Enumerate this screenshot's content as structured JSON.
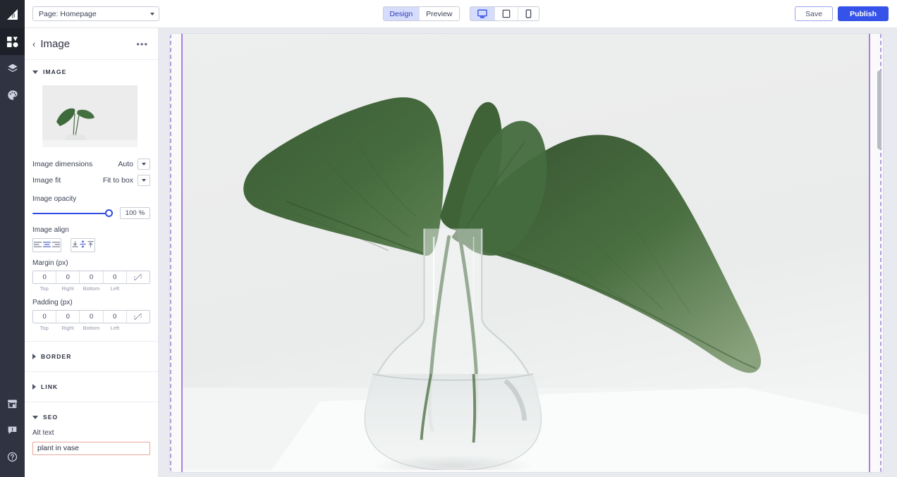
{
  "topbar": {
    "page_select": {
      "value": "Page: Homepage",
      "icon": "chevron-down-icon"
    },
    "modes": [
      {
        "label": "Design",
        "active": true
      },
      {
        "label": "Preview",
        "active": false
      }
    ],
    "devices": [
      {
        "icon": "desktop-icon",
        "active": true
      },
      {
        "icon": "tablet-icon",
        "active": false
      },
      {
        "icon": "mobile-icon",
        "active": false
      }
    ],
    "save_label": "Save",
    "publish_label": "Publish"
  },
  "rail": {
    "logo": "builder-logo",
    "items": [
      {
        "icon": "widgets-icon",
        "active": true
      },
      {
        "icon": "layers-icon",
        "active": false
      },
      {
        "icon": "palette-icon",
        "active": false
      }
    ],
    "bottom_items": [
      {
        "icon": "store-icon"
      },
      {
        "icon": "feedback-icon"
      },
      {
        "icon": "help-icon"
      }
    ]
  },
  "panel": {
    "back_icon": "chevron-left-icon",
    "title": "Image",
    "more_icon": "ellipsis-icon",
    "sections": {
      "image": {
        "label": "IMAGE",
        "expanded": true,
        "thumbnail_alt": "plant in vase thumbnail",
        "dimensions": {
          "label": "Image dimensions",
          "value": "Auto"
        },
        "fit": {
          "label": "Image fit",
          "value": "Fit to box"
        },
        "opacity": {
          "label": "Image opacity",
          "value": "100",
          "unit": "%",
          "percent": 100
        },
        "align": {
          "label": "Image align",
          "horizontal": [
            {
              "icon": "align-left-icon",
              "active": false
            },
            {
              "icon": "align-center-icon",
              "active": true
            },
            {
              "icon": "align-right-icon",
              "active": false
            }
          ],
          "vertical": [
            {
              "icon": "align-bottom-icon",
              "active": false
            },
            {
              "icon": "align-middle-icon",
              "active": true
            },
            {
              "icon": "align-top-icon",
              "active": false
            }
          ]
        },
        "margin": {
          "title": "Margin (px)",
          "values": [
            "0",
            "0",
            "0",
            "0"
          ],
          "captions": [
            "Top",
            "Right",
            "Bottom",
            "Left"
          ],
          "link_icon": "unlink-icon"
        },
        "padding": {
          "title": "Padding (px)",
          "values": [
            "0",
            "0",
            "0",
            "0"
          ],
          "captions": [
            "Top",
            "Right",
            "Bottom",
            "Left"
          ],
          "link_icon": "unlink-icon"
        }
      },
      "border": {
        "label": "BORDER",
        "expanded": false
      },
      "link": {
        "label": "LINK",
        "expanded": false
      },
      "seo": {
        "label": "SEO",
        "expanded": true,
        "alt_text_label": "Alt text",
        "alt_text_value": "plant in vase",
        "alt_text_placeholder": "Alt text"
      }
    }
  },
  "canvas": {
    "image_alt": "plant in vase",
    "selection": "image-element-selected"
  },
  "colors": {
    "accent": "#3553e8",
    "accent_soft": "#d6dcfb",
    "rail_bg": "#2f3342",
    "selection_purple": "#a87fe0",
    "error_border": "#e8a79b",
    "canvas_bg": "#e8eaf0"
  }
}
